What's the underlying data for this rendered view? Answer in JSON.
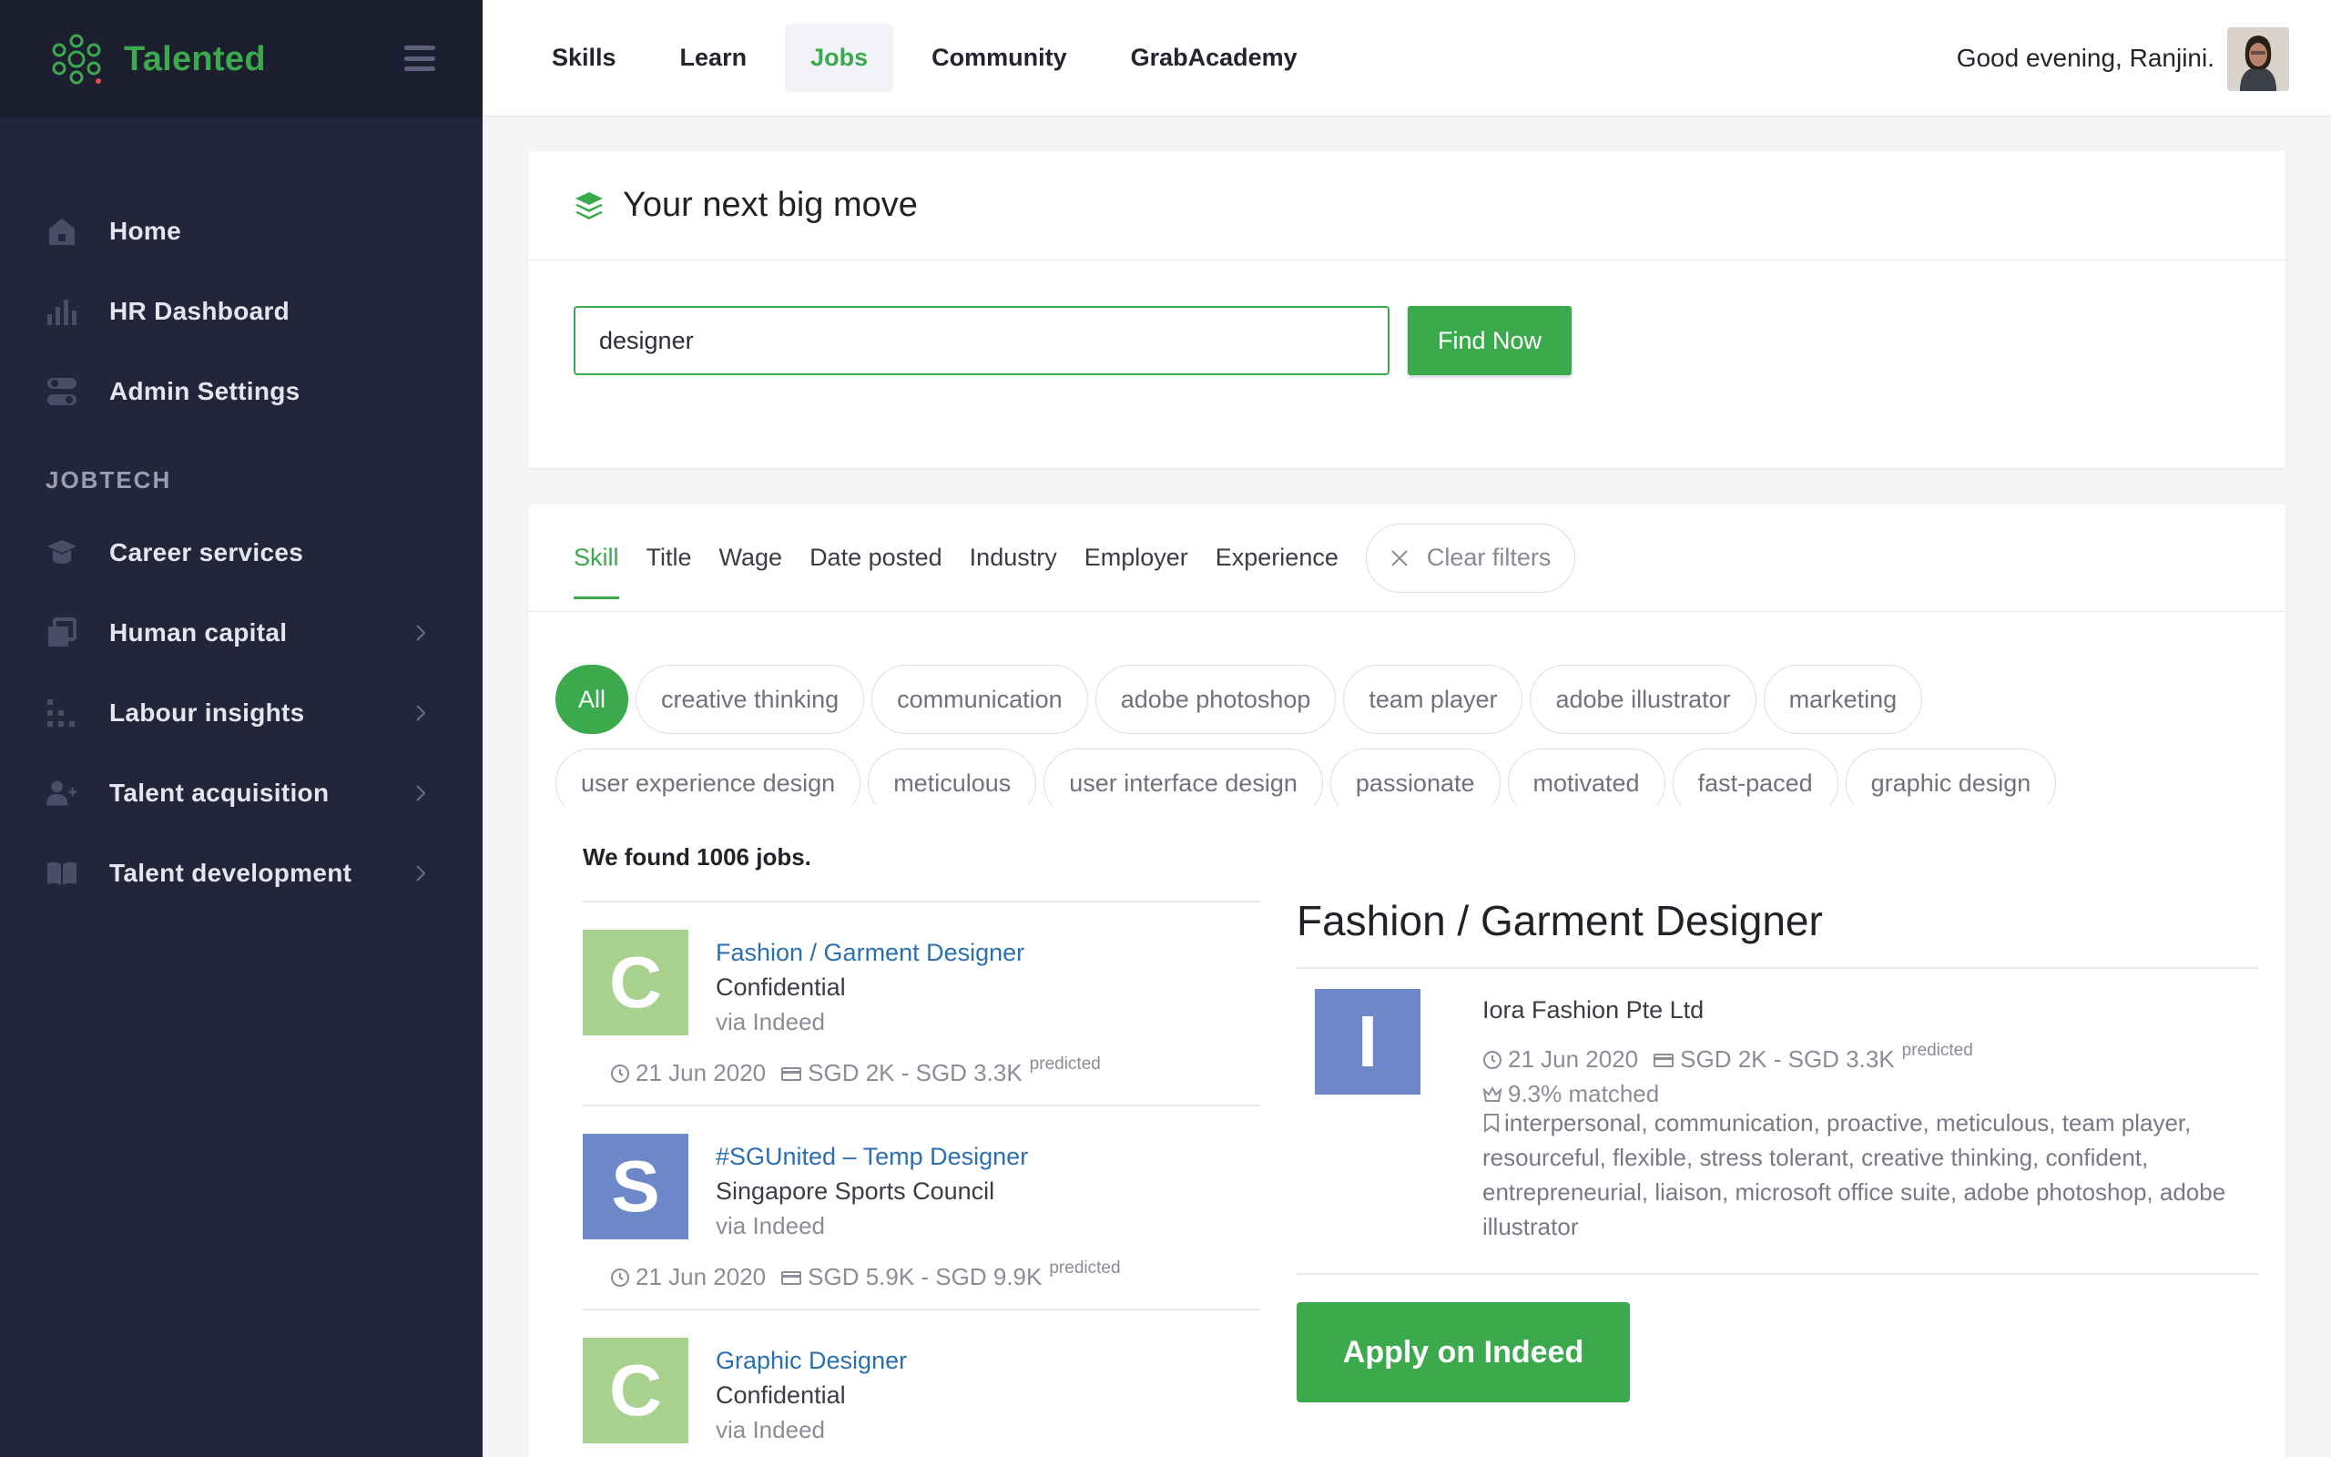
{
  "app": {
    "name": "Talented",
    "brand_color": "#3aaa4c"
  },
  "sidebar": {
    "items": [
      {
        "label": "Home",
        "icon": "home-icon"
      },
      {
        "label": "HR Dashboard",
        "icon": "bar-chart-icon"
      },
      {
        "label": "Admin Settings",
        "icon": "toggle-icon"
      }
    ],
    "section_label": "JOBTECH",
    "jobtech_items": [
      {
        "label": "Career services",
        "icon": "graduation-cap-icon"
      },
      {
        "label": "Human capital",
        "icon": "copy-icon"
      },
      {
        "label": "Labour insights",
        "icon": "dots-chart-icon"
      },
      {
        "label": "Talent acquisition",
        "icon": "add-user-icon"
      },
      {
        "label": "Talent development",
        "icon": "book-icon"
      }
    ]
  },
  "topbar": {
    "tabs": [
      "Skills",
      "Learn",
      "Jobs",
      "Community",
      "GrabAcademy"
    ],
    "active_tab": "Jobs",
    "greeting": "Good evening,  Ranjini."
  },
  "search": {
    "title": "Your next big move",
    "query": "designer",
    "button": "Find Now"
  },
  "filters": {
    "tabs": [
      "Skill",
      "Title",
      "Wage",
      "Date posted",
      "Industry",
      "Employer",
      "Experience"
    ],
    "active_tab": "Skill",
    "clear": "Clear filters",
    "chips_row1": [
      "All",
      "creative thinking",
      "communication",
      "adobe photoshop",
      "team player",
      "adobe illustrator",
      "marketing"
    ],
    "chips_row2": [
      "user experience design",
      "meticulous",
      "user interface design",
      "passionate",
      "motivated",
      "fast-paced",
      "graphic design"
    ]
  },
  "results": {
    "summary": "We found 1006 jobs.",
    "jobs": [
      {
        "letter": "C",
        "logo_color": "#a9d18e",
        "title": "Fashion / Garment Designer",
        "company": "Confidential",
        "via": "via Indeed",
        "date": "21 Jun 2020",
        "salary": "SGD 2K - SGD 3.3K",
        "salary_note": "predicted"
      },
      {
        "letter": "S",
        "logo_color": "#6e87c8",
        "title": "#SGUnited – Temp Designer",
        "company": "Singapore Sports Council",
        "via": "via Indeed",
        "date": "21 Jun 2020",
        "salary": "SGD 5.9K - SGD 9.9K",
        "salary_note": "predicted"
      },
      {
        "letter": "C",
        "logo_color": "#a9d18e",
        "title": "Graphic Designer",
        "company": "Confidential",
        "via": "via Indeed"
      }
    ]
  },
  "detail": {
    "title": "Fashion / Garment Designer",
    "letter": "I",
    "company": "Iora Fashion Pte Ltd",
    "date": "21 Jun 2020",
    "salary": "SGD 2K - SGD 3.3K",
    "salary_note": "predicted",
    "match": "9.3% matched",
    "skills": "interpersonal, communication, proactive, meticulous, team player, resourceful, flexible, stress tolerant, creative thinking, confident, entrepreneurial, liaison, microsoft office suite, adobe photoshop, adobe illustrator",
    "apply": "Apply on Indeed"
  }
}
